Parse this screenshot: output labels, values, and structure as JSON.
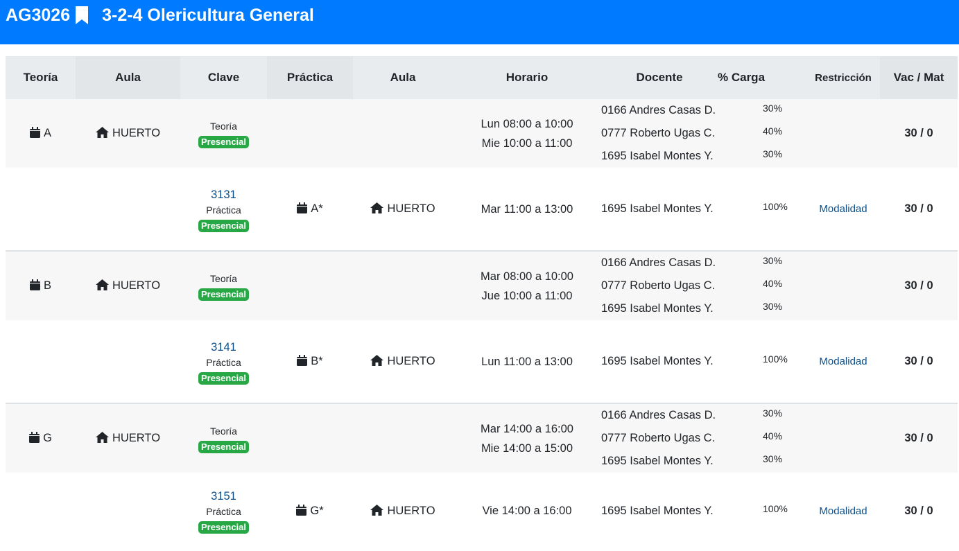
{
  "course": {
    "code": "AG3026",
    "title": "3-2-4 Olericultura General",
    "bookmark_icon": "bookmark-icon"
  },
  "colors": {
    "header_bg": "#007bff",
    "badge_green": "#28a745",
    "link_blue": "#0b4f8a",
    "table_header_bg": "#e9ecef",
    "row_stripe": "#f7f7f7"
  },
  "table": {
    "headers": {
      "theory": "Teoría",
      "room1": "Aula",
      "key": "Clave",
      "practice": "Práctica",
      "room2": "Aula",
      "schedule": "Horario",
      "teacher": "Docente",
      "load": "% Carga",
      "restriction": "Restricción",
      "vac_mat": "Vac / Mat"
    },
    "rows": [
      {
        "kind": "theory",
        "group": "A",
        "room": "HUERTO",
        "key_type": "Teoría",
        "modality": "Presencial",
        "schedule": [
          "Lun 08:00 a 10:00",
          "Mie 10:00 a 11:00"
        ],
        "teachers": [
          {
            "name": "0166 Andres Casas D.",
            "load": "30%"
          },
          {
            "name": "0777 Roberto Ugas C.",
            "load": "40%"
          },
          {
            "name": "1695 Isabel Montes Y.",
            "load": "30%"
          }
        ],
        "vac_mat": "30 / 0"
      },
      {
        "kind": "practice",
        "key": "3131",
        "key_type": "Práctica",
        "modality": "Presencial",
        "practice_group": "A*",
        "room": "HUERTO",
        "schedule": [
          "Mar 11:00 a 13:00"
        ],
        "teachers": [
          {
            "name": "1695 Isabel Montes Y.",
            "load": "100%"
          }
        ],
        "restriction": "Modalidad",
        "vac_mat": "30 / 0"
      },
      {
        "kind": "theory",
        "group": "B",
        "room": "HUERTO",
        "key_type": "Teoría",
        "modality": "Presencial",
        "schedule": [
          "Mar 08:00 a 10:00",
          "Jue 10:00 a 11:00"
        ],
        "teachers": [
          {
            "name": "0166 Andres Casas D.",
            "load": "30%"
          },
          {
            "name": "0777 Roberto Ugas C.",
            "load": "40%"
          },
          {
            "name": "1695 Isabel Montes Y.",
            "load": "30%"
          }
        ],
        "vac_mat": "30 / 0"
      },
      {
        "kind": "practice",
        "key": "3141",
        "key_type": "Práctica",
        "modality": "Presencial",
        "practice_group": "B*",
        "room": "HUERTO",
        "schedule": [
          "Lun 11:00 a 13:00"
        ],
        "teachers": [
          {
            "name": "1695 Isabel Montes Y.",
            "load": "100%"
          }
        ],
        "restriction": "Modalidad",
        "vac_mat": "30 / 0"
      },
      {
        "kind": "theory",
        "group": "G",
        "room": "HUERTO",
        "key_type": "Teoría",
        "modality": "Presencial",
        "schedule": [
          "Mar 14:00 a 16:00",
          "Mie 14:00 a 15:00"
        ],
        "teachers": [
          {
            "name": "0166 Andres Casas D.",
            "load": "30%"
          },
          {
            "name": "0777 Roberto Ugas C.",
            "load": "40%"
          },
          {
            "name": "1695 Isabel Montes Y.",
            "load": "30%"
          }
        ],
        "vac_mat": "30 / 0"
      },
      {
        "kind": "practice",
        "key": "3151",
        "key_type": "Práctica",
        "modality": "Presencial",
        "practice_group": "G*",
        "room": "HUERTO",
        "schedule": [
          "Vie 14:00 a 16:00"
        ],
        "teachers": [
          {
            "name": "1695 Isabel Montes Y.",
            "load": "100%"
          }
        ],
        "restriction": "Modalidad",
        "vac_mat": "30 / 0"
      }
    ]
  }
}
